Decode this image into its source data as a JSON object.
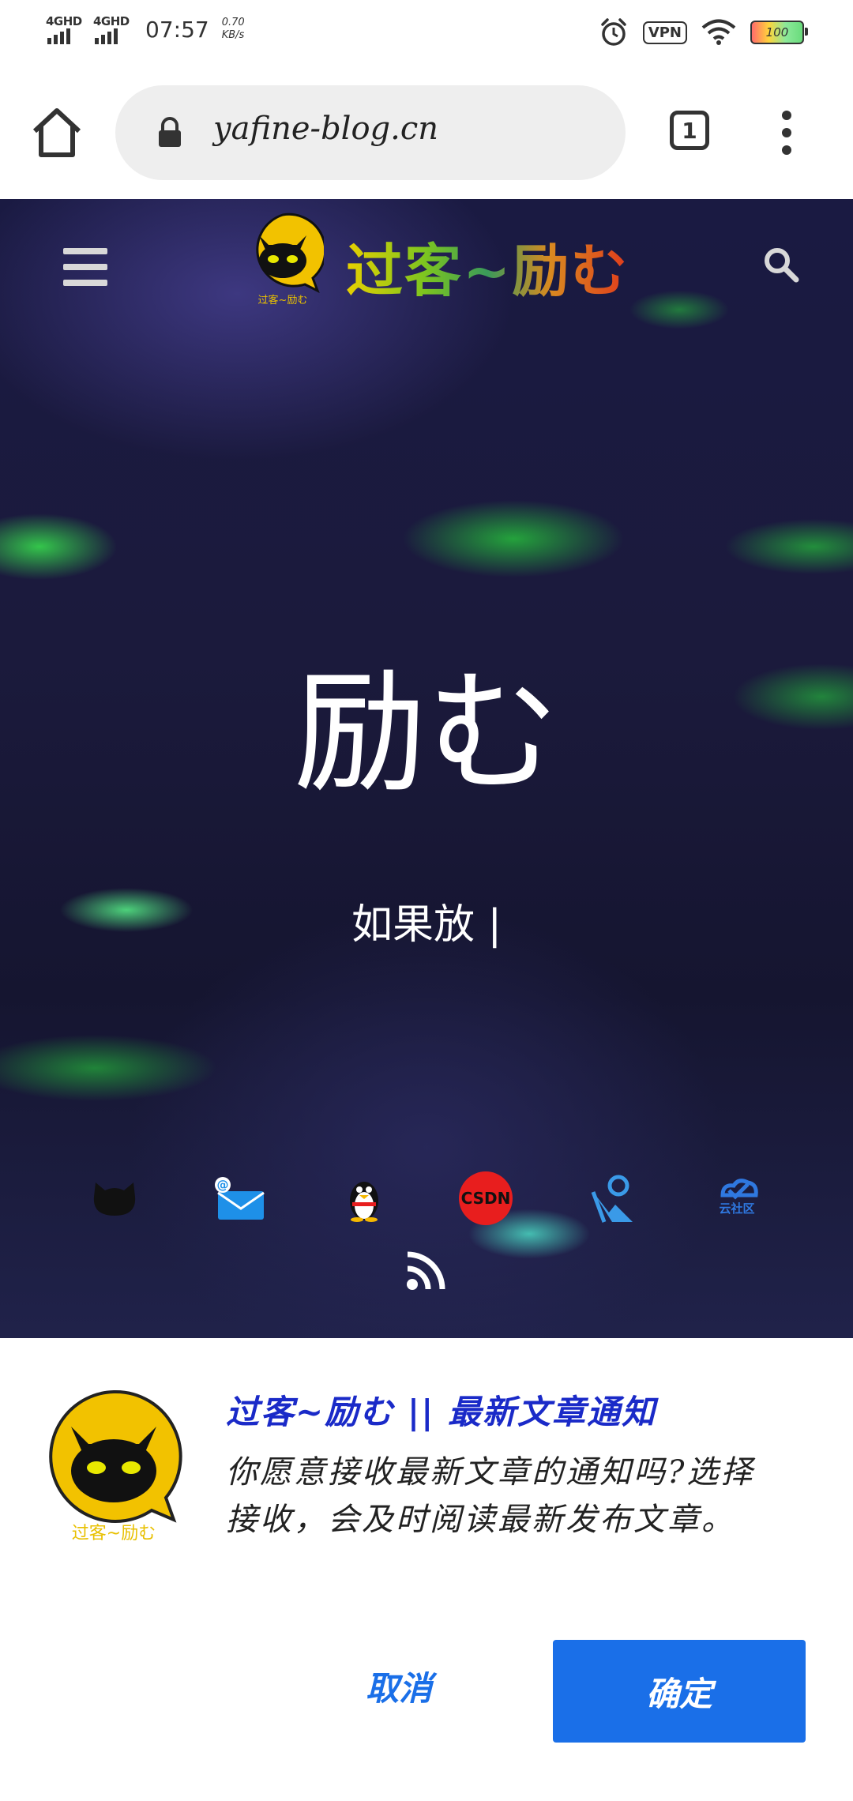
{
  "status_bar": {
    "signal1_label": "4GHD",
    "signal2_label": "4GHD",
    "time": "07:57",
    "speed_value": "0.70",
    "speed_unit": "KB/s",
    "vpn_label": "VPN",
    "battery_level": "100"
  },
  "browser": {
    "url": "yafine-blog.cn",
    "tab_count": "1"
  },
  "hero": {
    "site_title": "过客~励む",
    "logo_caption": "过客~励む",
    "heading": "励む",
    "subtitle": "如果放 |",
    "social_icons": [
      "github-icon",
      "email-icon",
      "qq-icon",
      "csdn-icon",
      "yuque-icon",
      "cloud-community-icon"
    ],
    "csdn_label": "CSDN",
    "cloud_label": "云社区"
  },
  "notification": {
    "title": "过客~励む || 最新文章通知",
    "body": "你愿意接收最新文章的通知吗?选择接收，会及时阅读最新发布文章。",
    "logo_caption": "过客~励む",
    "cancel_label": "取消",
    "confirm_label": "确定"
  },
  "colors": {
    "accent": "#1a6fe8",
    "title_blue": "#1a2ac8",
    "logo_yellow": "#f2c200"
  }
}
